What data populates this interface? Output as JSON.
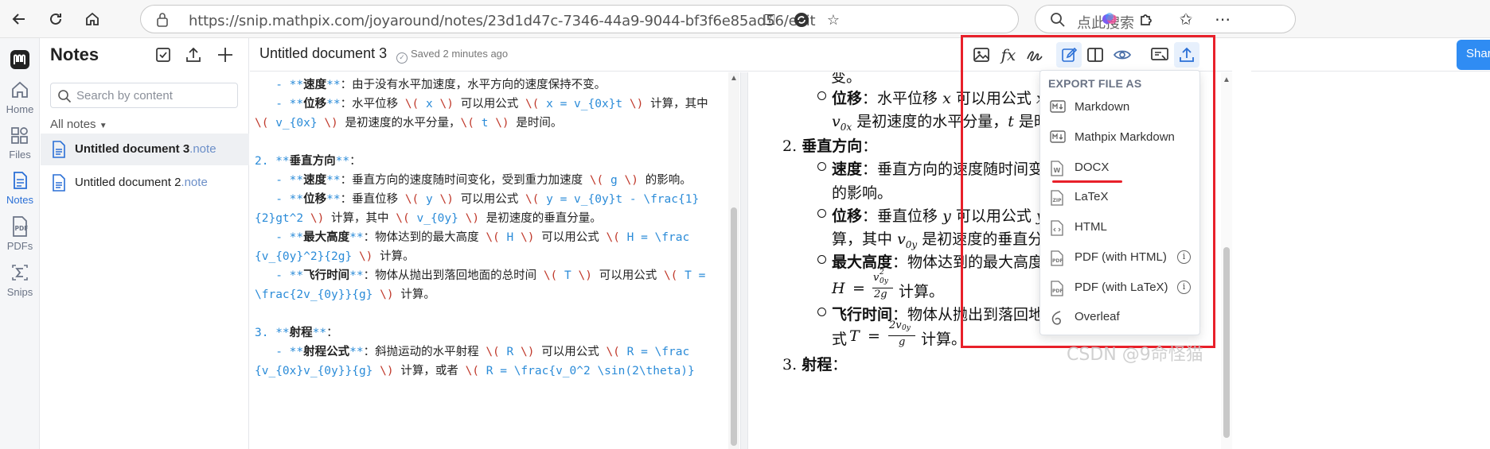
{
  "browser": {
    "url": "https://snip.mathpix.com/joyaround/notes/23d1d47c-7346-44a9-9044-bf3f6e85ad56/edit",
    "search_placeholder": "点此搜索"
  },
  "rail": {
    "items": [
      {
        "label": "Home",
        "icon": "home-icon"
      },
      {
        "label": "Files",
        "icon": "files-icon"
      },
      {
        "label": "Notes",
        "icon": "notes-icon",
        "active": true
      },
      {
        "label": "PDFs",
        "icon": "pdf-icon"
      },
      {
        "label": "Snips",
        "icon": "sigma-icon"
      }
    ]
  },
  "notes_panel": {
    "title": "Notes",
    "search_placeholder": "Search by content",
    "filter_label": "All notes",
    "notes": [
      {
        "name": "Untitled document 3",
        "ext": ".note",
        "selected": true
      },
      {
        "name": "Untitled document 2",
        "ext": ".note",
        "selected": false
      }
    ]
  },
  "doc": {
    "title": "Untitled document 3",
    "saved_status": "Saved 2 minutes ago",
    "share_label": "Share"
  },
  "export_menu": {
    "heading": "EXPORT FILE AS",
    "items": [
      {
        "label": "Markdown",
        "icon": "markdown-icon"
      },
      {
        "label": "Mathpix Markdown",
        "icon": "markdown-icon"
      },
      {
        "label": "DOCX",
        "icon": "docx-icon"
      },
      {
        "label": "LaTeX",
        "icon": "latex-icon"
      },
      {
        "label": "HTML",
        "icon": "html-icon"
      },
      {
        "label": "PDF (with HTML)",
        "icon": "pdf-file-icon",
        "info": true
      },
      {
        "label": "PDF (with LaTeX)",
        "icon": "pdf-file-icon",
        "info": true
      },
      {
        "label": "Overleaf",
        "icon": "overleaf-icon"
      }
    ]
  },
  "editor": {
    "lines": [
      [
        [
          "   - ",
          "acc"
        ],
        [
          "**",
          "acc"
        ],
        [
          "速度",
          "b"
        ],
        [
          "**",
          "acc"
        ],
        [
          "：由于没有水平加速度，水平方向的速度保持不变。",
          ""
        ]
      ],
      [
        [
          "   - ",
          "acc"
        ],
        [
          "**",
          "acc"
        ],
        [
          "位移",
          "b"
        ],
        [
          "**",
          "acc"
        ],
        [
          "：水平位移 ",
          ""
        ],
        [
          "\\(",
          "dl"
        ],
        [
          " x ",
          "mth"
        ],
        [
          "\\)",
          "dl"
        ],
        [
          " 可以用公式 ",
          ""
        ],
        [
          "\\(",
          "dl"
        ],
        [
          " x = v_{0x}t ",
          "mth"
        ],
        [
          "\\)",
          "dl"
        ],
        [
          " 计算，其中",
          ""
        ]
      ],
      [
        [
          "\\(",
          "dl"
        ],
        [
          " v_{0x} ",
          "mth"
        ],
        [
          "\\)",
          "dl"
        ],
        [
          " 是初速度的水平分量，",
          ""
        ],
        [
          "\\(",
          "dl"
        ],
        [
          " t ",
          "mth"
        ],
        [
          "\\)",
          "dl"
        ],
        [
          " 是时间。",
          ""
        ]
      ],
      [
        [
          "",
          ""
        ]
      ],
      [
        [
          "2. ",
          "acc"
        ],
        [
          "**",
          "acc"
        ],
        [
          "垂直方向",
          "b"
        ],
        [
          "**",
          "acc"
        ],
        [
          "：",
          ""
        ]
      ],
      [
        [
          "   - ",
          "acc"
        ],
        [
          "**",
          "acc"
        ],
        [
          "速度",
          "b"
        ],
        [
          "**",
          "acc"
        ],
        [
          "：垂直方向的速度随时间变化，受到重力加速度 ",
          ""
        ],
        [
          "\\(",
          "dl"
        ],
        [
          " g ",
          "mth"
        ],
        [
          "\\)",
          "dl"
        ],
        [
          " 的影响。",
          ""
        ]
      ],
      [
        [
          "   - ",
          "acc"
        ],
        [
          "**",
          "acc"
        ],
        [
          "位移",
          "b"
        ],
        [
          "**",
          "acc"
        ],
        [
          "：垂直位移 ",
          ""
        ],
        [
          "\\(",
          "dl"
        ],
        [
          " y ",
          "mth"
        ],
        [
          "\\)",
          "dl"
        ],
        [
          " 可以用公式 ",
          ""
        ],
        [
          "\\(",
          "dl"
        ],
        [
          " y = v_{0y}t - \\frac{1}",
          "mth"
        ]
      ],
      [
        [
          "{2}gt^2 ",
          "mth"
        ],
        [
          "\\)",
          "dl"
        ],
        [
          " 计算，其中 ",
          ""
        ],
        [
          "\\(",
          "dl"
        ],
        [
          " v_{0y} ",
          "mth"
        ],
        [
          "\\)",
          "dl"
        ],
        [
          " 是初速度的垂直分量。",
          ""
        ]
      ],
      [
        [
          "   - ",
          "acc"
        ],
        [
          "**",
          "acc"
        ],
        [
          "最大高度",
          "b"
        ],
        [
          "**",
          "acc"
        ],
        [
          "：物体达到的最大高度 ",
          ""
        ],
        [
          "\\(",
          "dl"
        ],
        [
          " H ",
          "mth"
        ],
        [
          "\\)",
          "dl"
        ],
        [
          " 可以用公式 ",
          ""
        ],
        [
          "\\(",
          "dl"
        ],
        [
          " H = \\frac",
          "mth"
        ]
      ],
      [
        [
          "{v_{0y}^2}{2g} ",
          "mth"
        ],
        [
          "\\)",
          "dl"
        ],
        [
          " 计算。",
          ""
        ]
      ],
      [
        [
          "   - ",
          "acc"
        ],
        [
          "**",
          "acc"
        ],
        [
          "飞行时间",
          "b"
        ],
        [
          "**",
          "acc"
        ],
        [
          "：物体从抛出到落回地面的总时间 ",
          ""
        ],
        [
          "\\(",
          "dl"
        ],
        [
          " T ",
          "mth"
        ],
        [
          "\\)",
          "dl"
        ],
        [
          " 可以用公式 ",
          ""
        ],
        [
          "\\(",
          "dl"
        ],
        [
          " T =",
          "mth"
        ]
      ],
      [
        [
          "\\frac{2v_{0y}}{g} ",
          "mth"
        ],
        [
          "\\)",
          "dl"
        ],
        [
          " 计算。",
          ""
        ]
      ],
      [
        [
          "",
          ""
        ]
      ],
      [
        [
          "3. ",
          "acc"
        ],
        [
          "**",
          "acc"
        ],
        [
          "射程",
          "b"
        ],
        [
          "**",
          "acc"
        ],
        [
          "：",
          ""
        ]
      ],
      [
        [
          "   - ",
          "acc"
        ],
        [
          "**",
          "acc"
        ],
        [
          "射程公式",
          "b"
        ],
        [
          "**",
          "acc"
        ],
        [
          "：斜抛运动的水平射程 ",
          ""
        ],
        [
          "\\(",
          "dl"
        ],
        [
          " R ",
          "mth"
        ],
        [
          "\\)",
          "dl"
        ],
        [
          " 可以用公式 ",
          ""
        ],
        [
          "\\(",
          "dl"
        ],
        [
          " R = \\frac",
          "mth"
        ]
      ],
      [
        [
          "{v_{0x}v_{0y}}{g} ",
          "mth"
        ],
        [
          "\\)",
          "dl"
        ],
        [
          " 计算，或者 ",
          ""
        ],
        [
          "\\(",
          "dl"
        ],
        [
          " R = \\frac{v_0^2 \\sin(2\\theta)}",
          "mth"
        ]
      ]
    ]
  },
  "preview": {
    "l0": "变。",
    "l1_b": "位移",
    "l1_t": "：水平位移",
    "l1_v": "x",
    "l1_t2": "可以用公式",
    "l1_v2": "x",
    "l2_v": "v",
    "l2_sub": "0x",
    "l2_t": "是初速度的水平分量，",
    "l2_v2": "t",
    "l2_t2": "是时",
    "h2": "2.",
    "h2_b": "垂直方向",
    "h2_c": "：",
    "l3_b": "速度",
    "l3_t": "：垂直方向的速度随时间变",
    "l4": "的影响。",
    "l5_b": "位移",
    "l5_t": "：垂直位移",
    "l5_v": "y",
    "l5_t2": "可以用公式",
    "l5_v2": "y",
    "l6_t": "算，其中",
    "l6_v": "v",
    "l6_sub": "0y",
    "l6_t2": "是初速度的垂直分",
    "l7_b": "最大高度",
    "l7_t": "：物体达到的最大高度",
    "l8_v": "H",
    "l8_eq": "=",
    "l8_num": "v",
    "l8_num_sup": "2",
    "l8_num_sub": "0y",
    "l8_den": "2g",
    "l8_t": "计算。",
    "l9_b": "飞行时间",
    "l9_t": "：物体从抛出到落回地",
    "l10_t": "式",
    "l10_v": "T",
    "l10_eq": "=",
    "l10_num": "2v",
    "l10_num_sub": "0y",
    "l10_den": "g",
    "l10_t2": "计算。",
    "h3": "3.",
    "h3_b": "射程",
    "h3_c": "："
  },
  "watermark": "CSDN @9命怪猫"
}
